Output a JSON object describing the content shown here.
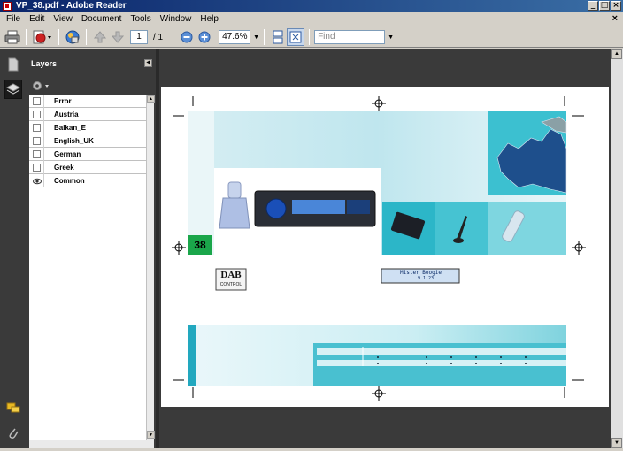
{
  "window": {
    "title": "VP_38.pdf - Adobe Reader",
    "buttons": [
      "_",
      "□",
      "×"
    ]
  },
  "menubar": {
    "items": [
      "File",
      "Edit",
      "View",
      "Document",
      "Tools",
      "Window",
      "Help"
    ],
    "close_doc": "×"
  },
  "toolbar": {
    "page_current": "1",
    "page_total": "/ 1",
    "zoom": "47.6%",
    "find_placeholder": "Find"
  },
  "layers_panel": {
    "title": "Layers",
    "layers": [
      {
        "name": "Error",
        "visible": false
      },
      {
        "name": "Austria",
        "visible": false
      },
      {
        "name": "Balkan_E",
        "visible": false
      },
      {
        "name": "English_UK",
        "visible": false
      },
      {
        "name": "German",
        "visible": false
      },
      {
        "name": "Greek",
        "visible": false
      },
      {
        "name": "Common",
        "visible": true
      }
    ]
  },
  "page_content": {
    "page_number": "38",
    "dab_logo_top": "DAB",
    "dab_logo_bottom": "CONTROL",
    "display_text": "Mister Boogie",
    "display_subtext": "9  1.23"
  },
  "colors": {
    "accent_cyan": "#3bbfd0",
    "badge_green": "#1aa64a",
    "panel_dark": "#3a3a3a",
    "titlebar": "#0a246a"
  }
}
